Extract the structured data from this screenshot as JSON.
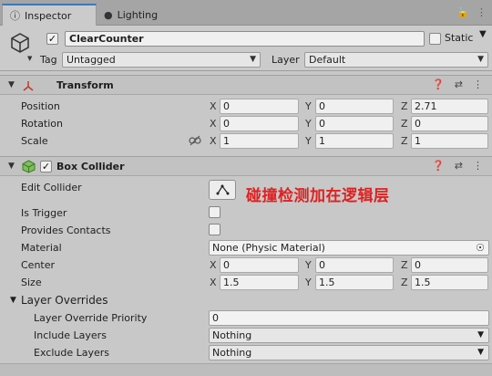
{
  "tabs": {
    "inspector": "Inspector",
    "lighting": "Lighting"
  },
  "gameobject": {
    "active": true,
    "name": "ClearCounter",
    "static_label": "Static",
    "static_checked": false,
    "tag_label": "Tag",
    "tag_value": "Untagged",
    "layer_label": "Layer",
    "layer_value": "Default"
  },
  "transform": {
    "title": "Transform",
    "position_label": "Position",
    "rotation_label": "Rotation",
    "scale_label": "Scale",
    "axes": {
      "x": "X",
      "y": "Y",
      "z": "Z"
    },
    "position": {
      "x": "0",
      "y": "0",
      "z": "2.71"
    },
    "rotation": {
      "x": "0",
      "y": "0",
      "z": "0"
    },
    "scale": {
      "x": "1",
      "y": "1",
      "z": "1"
    }
  },
  "box_collider": {
    "title": "Box Collider",
    "enabled": true,
    "edit_collider_label": "Edit Collider",
    "annotation": "碰撞检测加在逻辑层",
    "is_trigger_label": "Is Trigger",
    "provides_contacts_label": "Provides Contacts",
    "material_label": "Material",
    "material_value": "None (Physic Material)",
    "center_label": "Center",
    "center": {
      "x": "0",
      "y": "0",
      "z": "0"
    },
    "size_label": "Size",
    "size": {
      "x": "1.5",
      "y": "1.5",
      "z": "1.5"
    },
    "layer_overrides_label": "Layer Overrides",
    "override_priority_label": "Layer Override Priority",
    "override_priority_value": "0",
    "include_layers_label": "Include Layers",
    "include_layers_value": "Nothing",
    "exclude_layers_label": "Exclude Layers",
    "exclude_layers_value": "Nothing"
  },
  "colors": {
    "active_tab_accent": "#3a79bb",
    "annotation": "#e02020"
  }
}
